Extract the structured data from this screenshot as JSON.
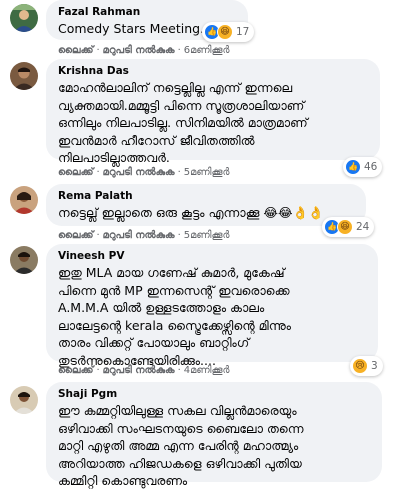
{
  "actions": {
    "like": "ലൈക്ക്",
    "reply": "മറുപടി നൽകുക",
    "separator": "·"
  },
  "comments": [
    {
      "name": "Fazal Rahman",
      "lines": [
        "Comedy Stars Meeting..😜"
      ],
      "time": "6മണിക്കൂർ",
      "reactions": {
        "icons": [
          "like-icon",
          "haha-icon"
        ],
        "count": "17"
      }
    },
    {
      "name": "Krishna Das",
      "lines": [
        "മോഹൻലാലിന് നട്ടെല്ലില്ല എന്ന് ഇന്നലെ",
        "വ്യക്തമായി.മമ്മൂട്ടി പിന്നെ സൂത്രശാലിയാണ്",
        "ഒന്നിലും നിലപാടില്ല. സിനിമയിൽ മാത്രമാണ്",
        "ഇവൻമാർ ഹീറോസ് ജീവിതത്തിൽ",
        "നിലപാടില്ലാത്തവർ."
      ],
      "time": "5മണിക്കൂർ",
      "reactions": {
        "icons": [
          "like-icon"
        ],
        "count": "46"
      }
    },
    {
      "name": "Rema Palath",
      "lines": [
        "നട്ടെല്ല് ഇല്ലാതെ ഒരു കൂട്ടം എന്നാക്കൂ 😂😂👌👌"
      ],
      "time": "5മണിക്കൂർ",
      "reactions": {
        "icons": [
          "like-icon",
          "haha-icon"
        ],
        "count": "24"
      }
    },
    {
      "name": "Vineesh PV",
      "lines": [
        "ഇതു MLA മായ ഗണേഷ് കുമാർ, മുകേഷ്",
        "പിന്നെ മുൻ MP ഇന്നസെന്റ് ഇവരൊക്കെ",
        "A.M.M.A യിൽ ഉള്ളടത്തോളം കാലം",
        "ലാലേട്ടന്റെ kerala സ്ട്രൈക്കേഴ്സിന്റെ മിന്നും",
        "താരം വിക്കറ്റ് പോയാലും ബാറ്റിംഗ്",
        "തുടർന്നുകൊണ്ടേയിരിക്കും...."
      ],
      "time": "4മണിക്കൂർ",
      "reactions": {
        "icons": [
          "sad-icon"
        ],
        "count": "3"
      }
    },
    {
      "name": "Shaji Pgm",
      "lines": [
        "ഈ കമ്മറ്റിയിലുള്ള സകല വില്ലൻമാരെയും",
        "ഒഴിവാക്കി സംഘടനയുടെ ബൈലോ തന്നെ",
        "മാറ്റി എഴുതി അമ്മ എന്ന പേരിന്റ മഹാത്മ്യം",
        "അറിയാത്ത ഹിജഡകളെ ഒഴിവാക്കി പുതിയ",
        "കമ്മിറ്റി കൊണ്ടുവരണം"
      ],
      "time": "",
      "reactions": null
    }
  ]
}
